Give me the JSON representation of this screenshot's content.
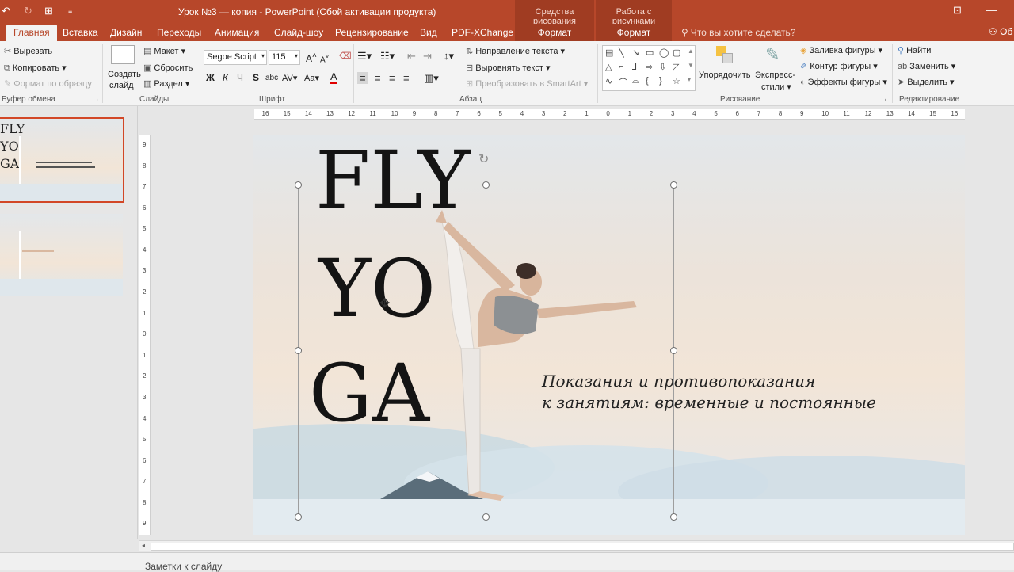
{
  "window": {
    "title": "Урок №3 — копия - PowerPoint (Сбой активации продукта)",
    "context_drawing": "Средства рисования",
    "context_picture": "Работа с рисунками"
  },
  "tabs": [
    "Главная",
    "Вставка",
    "Дизайн",
    "Переходы",
    "Анимация",
    "Слайд-шоу",
    "Рецензирование",
    "Вид",
    "PDF-XChange"
  ],
  "context_tabs": [
    "Формат",
    "Формат"
  ],
  "tell_me": "Что вы хотите сделать?",
  "user_partial": "Об",
  "ribbon": {
    "clipboard": {
      "cut": "Вырезать",
      "copy": "Копировать",
      "format_painter": "Формат по образцу",
      "group": "Буфер обмена"
    },
    "slides": {
      "new_slide_1": "Создать",
      "new_slide_2": "слайд",
      "layout": "Макет",
      "reset": "Сбросить",
      "section": "Раздел",
      "group": "Слайды"
    },
    "font": {
      "name": "Segoe Script",
      "size": "115",
      "group": "Шрифт",
      "bold": "Ж",
      "italic": "К",
      "underline": "Ч",
      "shadow": "S",
      "strike": "abc",
      "spacing": "AV",
      "case": "Aa",
      "color": "A"
    },
    "paragraph": {
      "text_direction": "Направление текста",
      "align_text": "Выровнять текст",
      "smartart": "Преобразовать в SmartArt",
      "group": "Абзац"
    },
    "drawing": {
      "arrange": "Упорядочить",
      "quick_styles_1": "Экспресс-",
      "quick_styles_2": "стили",
      "fill": "Заливка фигуры",
      "outline": "Контур фигуры",
      "effects": "Эффекты фигуры",
      "group": "Рисование"
    },
    "editing": {
      "find": "Найти",
      "replace": "Заменить",
      "select": "Выделить",
      "group": "Редактирование"
    }
  },
  "slide": {
    "title_lines": [
      "FLY",
      "YO",
      "GA"
    ],
    "subtitle_lines": [
      "Показания и противопоказания",
      "к занятиям: временные и постоянные"
    ]
  },
  "ruler": {
    "h": [
      "16",
      "15",
      "14",
      "13",
      "12",
      "11",
      "10",
      "9",
      "8",
      "7",
      "6",
      "5",
      "4",
      "3",
      "2",
      "1",
      "0",
      "1",
      "2",
      "3",
      "4",
      "5",
      "6",
      "7",
      "8",
      "9",
      "10",
      "11",
      "12",
      "13",
      "14",
      "15",
      "16"
    ],
    "v": [
      "9",
      "8",
      "7",
      "6",
      "5",
      "4",
      "3",
      "2",
      "1",
      "0",
      "1",
      "2",
      "3",
      "4",
      "5",
      "6",
      "7",
      "8",
      "9"
    ]
  },
  "notes_label": "Заметки к слайду",
  "colors": {
    "accent": "#b7472a",
    "selection": "#d24726"
  }
}
